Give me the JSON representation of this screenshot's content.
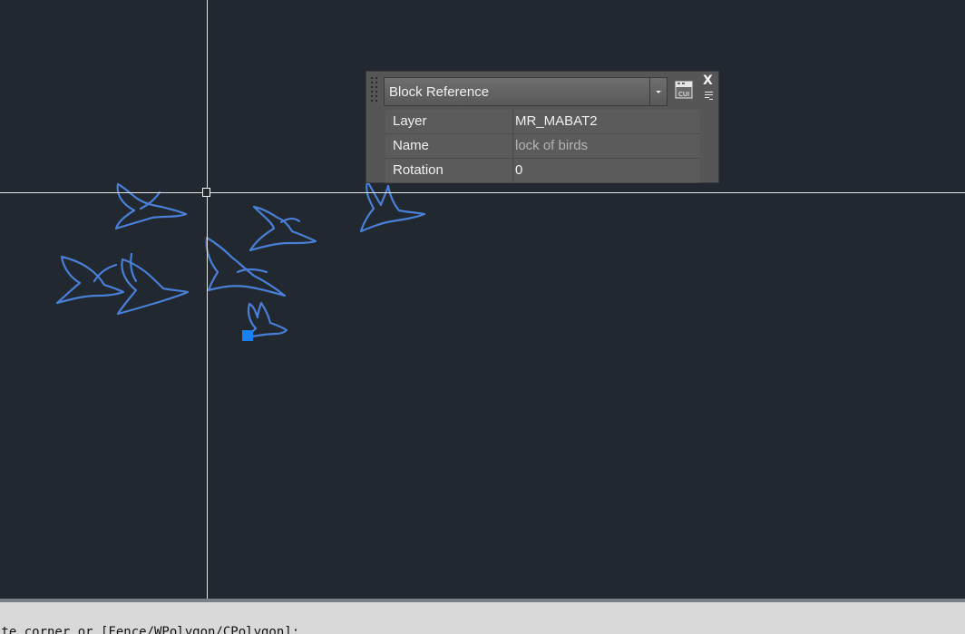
{
  "canvas": {
    "background": "#212830",
    "crosshair_color": "#e6e6e6",
    "grip_color": "#1a7ff0",
    "bird_color": "#4a7fd8",
    "object": "flock-of-birds-block"
  },
  "quick_properties": {
    "object_type": "Block Reference",
    "cui_label": "CUI",
    "close_label": "X",
    "rows": [
      {
        "key": "Layer",
        "value": "MR_MABAT2"
      },
      {
        "key": "Name",
        "value": "lock of birds"
      },
      {
        "key": "Rotation",
        "value": "0"
      }
    ]
  },
  "command_line": {
    "text": "ite corner or [Fence/WPolygon/CPolygon]:"
  }
}
